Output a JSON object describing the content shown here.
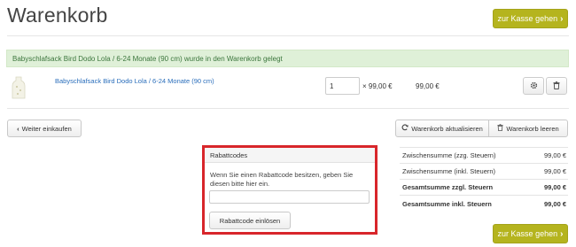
{
  "page": {
    "title": "Warenkorb"
  },
  "checkout": {
    "label": "zur Kasse gehen"
  },
  "alert": {
    "message": "Babyschlafsack Bird Dodo Lola / 6-24 Monate (90 cm) wurde in den Warenkorb gelegt"
  },
  "item": {
    "name": "Babyschlafsack Bird Dodo Lola / 6-24 Monate (90 cm)",
    "quantity": "1",
    "unit_price": "× 99,00 €",
    "total": "99,00 €"
  },
  "actions": {
    "continue_shopping": "Weiter einkaufen",
    "update_cart": "Warenkorb aktualisieren",
    "clear_cart": "Warenkorb leeren"
  },
  "coupon": {
    "heading": "Rabattcodes",
    "description": "Wenn Sie einen Rabattcode besitzen, geben Sie diesen bitte hier ein.",
    "input_value": "",
    "submit_label": "Rabattcode einlösen"
  },
  "totals": [
    {
      "label": "Zwischensumme (zzg. Steuern)",
      "value": "99,00 €"
    },
    {
      "label": "Zwischensumme (inkl. Steuern)",
      "value": "99,00 €"
    },
    {
      "label": "Gesamtsumme zzgl. Steuern",
      "value": "99,00 €"
    },
    {
      "label": "Gesamtsumme inkl. Steuern",
      "value": "99,00 €"
    }
  ],
  "colors": {
    "accent": "#b5b41e",
    "highlight_border": "#d8262b",
    "link": "#2a6ebb",
    "alert_bg": "#dff0d8"
  },
  "icons": [
    "chevron-right-icon",
    "chevron-left-icon",
    "refresh-icon",
    "trash-icon",
    "gear-icon"
  ]
}
